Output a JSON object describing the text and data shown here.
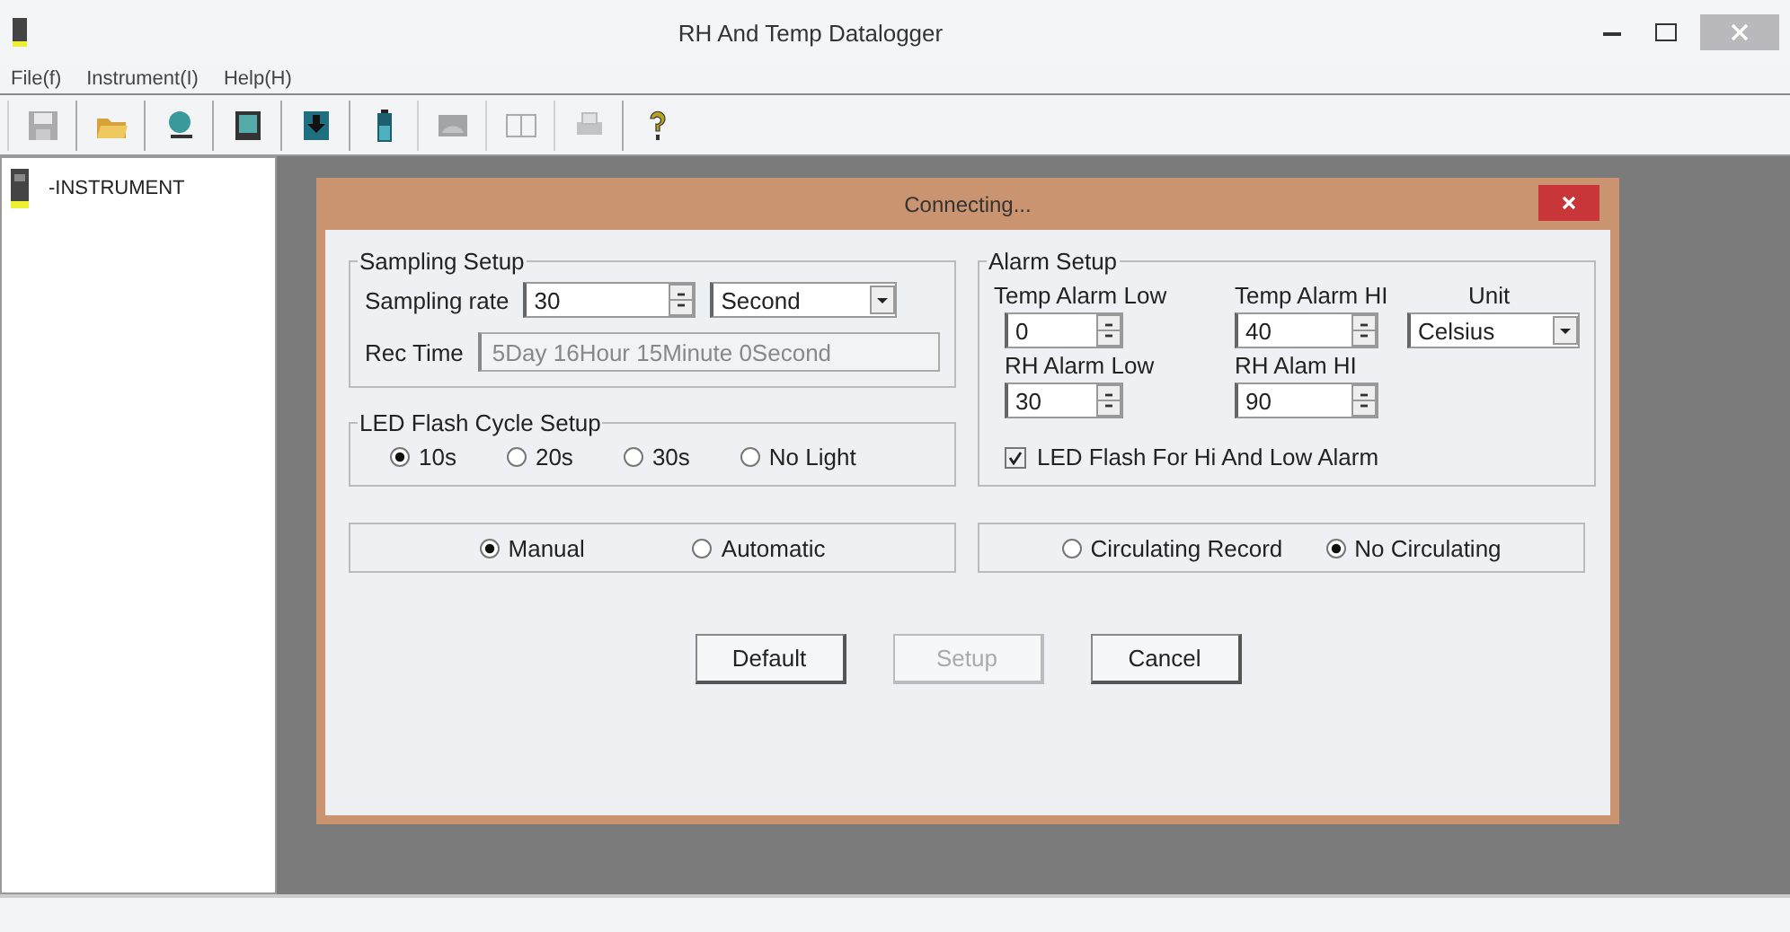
{
  "window": {
    "title": "RH And Temp Datalogger"
  },
  "menu": [
    "File(f)",
    "Instrument(I)",
    "Help(H)"
  ],
  "toolbar": [
    {
      "kind": "save",
      "disabled": true
    },
    {
      "kind": "open",
      "disabled": false
    },
    {
      "kind": "connect",
      "disabled": false
    },
    {
      "kind": "device",
      "disabled": false
    },
    {
      "kind": "download",
      "disabled": false
    },
    {
      "kind": "battery",
      "disabled": false
    },
    {
      "kind": "chart",
      "disabled": true
    },
    {
      "kind": "book",
      "disabled": true
    },
    {
      "kind": "print",
      "disabled": true
    },
    {
      "kind": "help",
      "disabled": false
    }
  ],
  "sidebar": {
    "items": [
      {
        "label": "-INSTRUMENT"
      }
    ]
  },
  "dialog": {
    "title": "Connecting...",
    "sampling": {
      "title": "Sampling Setup",
      "rate_label": "Sampling rate",
      "rate": "30",
      "unit": "Second",
      "rec_label": "Rec Time",
      "rec_time": "5Day 16Hour 15Minute 0Second"
    },
    "led": {
      "title": "LED Flash Cycle Setup",
      "options": [
        {
          "label": "10s",
          "selected": true
        },
        {
          "label": "20s",
          "selected": false
        },
        {
          "label": "30s",
          "selected": false
        },
        {
          "label": "No Light",
          "selected": false
        }
      ]
    },
    "alarm": {
      "title": "Alarm Setup",
      "temp_low_label": "Temp Alarm Low",
      "temp_low": "0",
      "temp_hi_label": "Temp Alarm HI",
      "temp_hi": "40",
      "unit_label": "Unit",
      "unit": "Celsius",
      "rh_low_label": "RH Alarm Low",
      "rh_low": "30",
      "rh_hi_label": "RH Alam HI",
      "rh_hi": "90",
      "led_alarm": {
        "label": "LED Flash For Hi And Low  Alarm",
        "checked": true
      }
    },
    "start_mode": [
      {
        "label": "Manual",
        "selected": true
      },
      {
        "label": "Automatic",
        "selected": false
      }
    ],
    "record_mode": [
      {
        "label": "Circulating Record",
        "selected": false
      },
      {
        "label": "No Circulating",
        "selected": true
      }
    ],
    "buttons": [
      {
        "label": "Default",
        "disabled": false
      },
      {
        "label": "Setup",
        "disabled": true
      },
      {
        "label": "Cancel",
        "disabled": false
      }
    ]
  }
}
